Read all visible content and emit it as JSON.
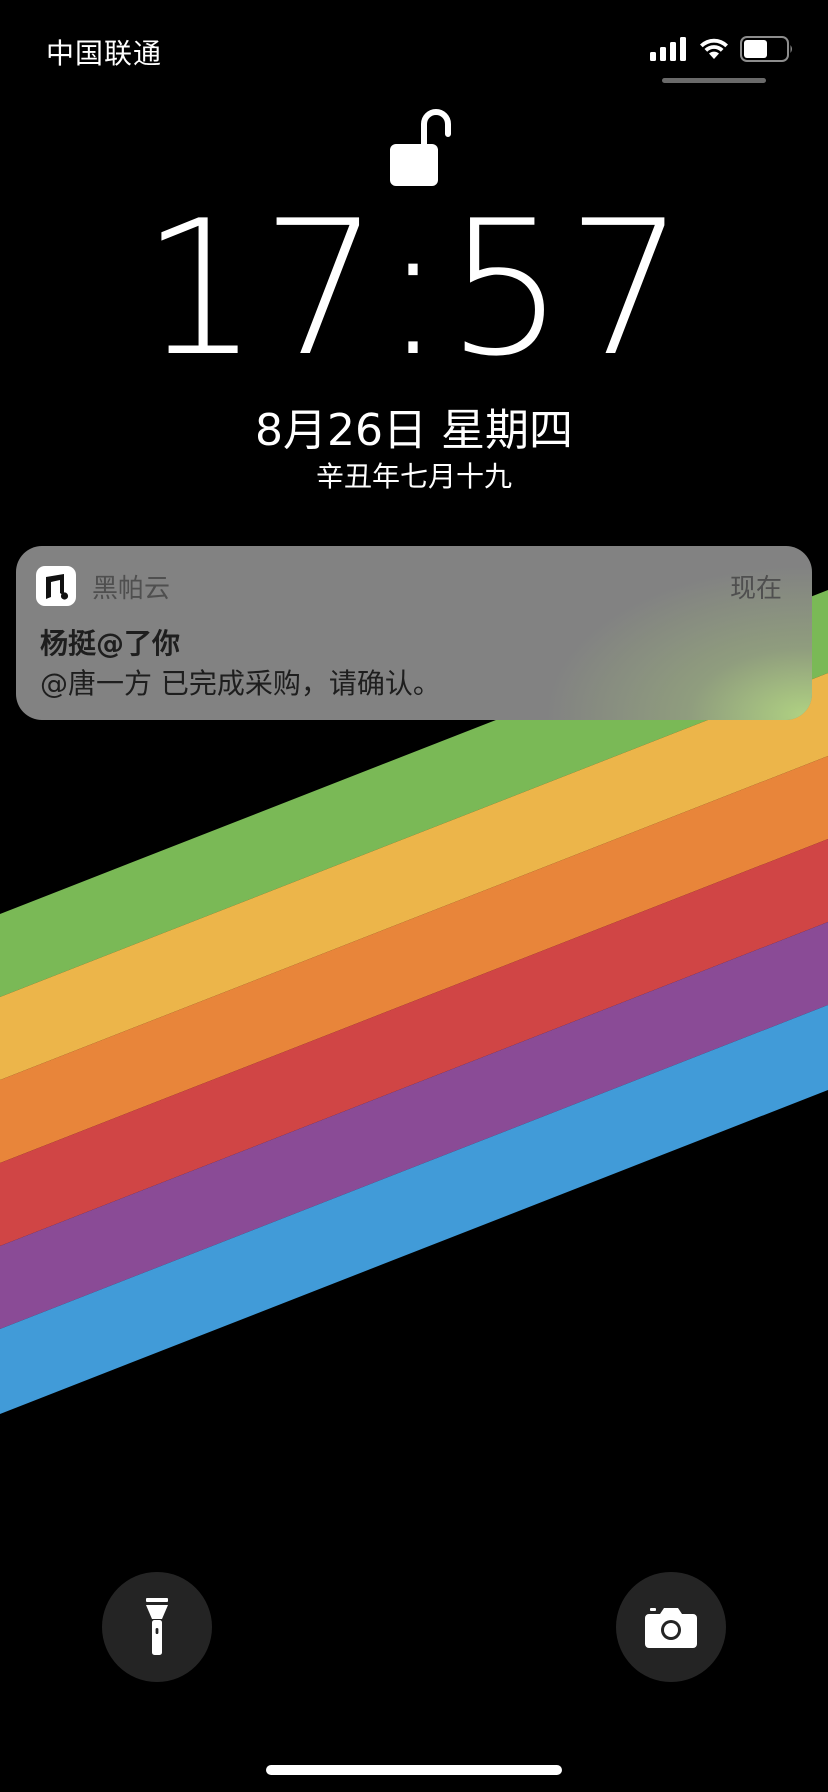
{
  "status_bar": {
    "carrier": "中国联通",
    "icons": [
      "signal-icon",
      "wifi-icon",
      "battery-icon"
    ],
    "battery_level_fraction": 0.55
  },
  "lock_screen": {
    "lock_state_icon": "unlocked-padlock-icon",
    "time": "17:57",
    "date": "8月26日 星期四",
    "lunar_date": "辛丑年七月十九"
  },
  "notification": {
    "app_name": "黑帕云",
    "time": "现在",
    "title": "杨挺@了你",
    "body": "@唐一方 已完成采购，请确认。"
  },
  "quick_actions": {
    "left_icon": "flashlight-icon",
    "right_icon": "camera-icon"
  },
  "wallpaper": {
    "background": "#000000",
    "stripe_colors": [
      "#7ab956",
      "#ecb54a",
      "#e8853a",
      "#d04545",
      "#8a4b96",
      "#419bd8"
    ]
  }
}
